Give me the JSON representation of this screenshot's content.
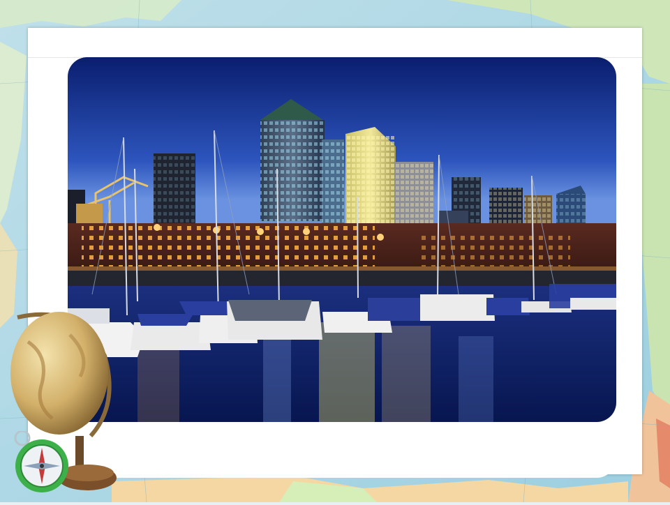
{
  "scene": {
    "description": "",
    "sky_colors": [
      "#0a1e6e",
      "#3a64c8",
      "#6a92e0"
    ],
    "water_color": "#0b1c5a",
    "light_color": "#ffb347",
    "accent_map_colors": [
      "#8fc6d8",
      "#cfe6c2",
      "#f3d9a6",
      "#e9a07a"
    ]
  },
  "icons": {
    "globe": "globe-icon",
    "compass": "compass-icon"
  }
}
